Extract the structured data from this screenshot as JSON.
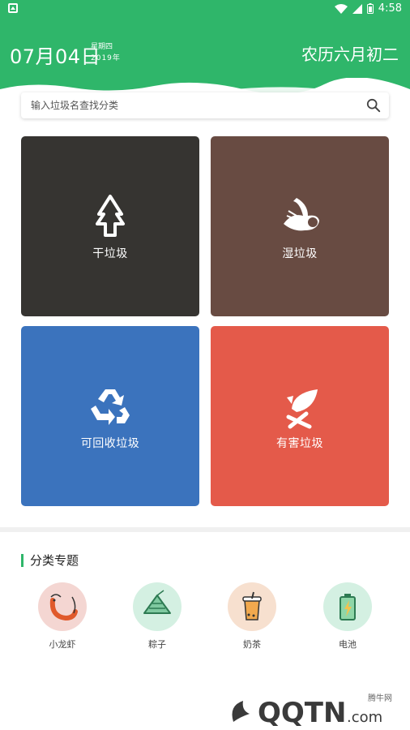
{
  "status_bar": {
    "time": "4:58"
  },
  "header": {
    "date": "07月04日",
    "weekday": "星期四",
    "year": "2019年",
    "lunar": "农历六月初二",
    "bg_color": "#2fb66a"
  },
  "search": {
    "placeholder": "输入垃圾名查找分类"
  },
  "categories": [
    {
      "label": "干垃圾",
      "color": "#363431",
      "icon": "dry-trash-icon"
    },
    {
      "label": "湿垃圾",
      "color": "#684b42",
      "icon": "wet-trash-icon"
    },
    {
      "label": "可回收垃圾",
      "color": "#3b73bd",
      "icon": "recycle-icon"
    },
    {
      "label": "有害垃圾",
      "color": "#e45a4a",
      "icon": "hazard-icon"
    }
  ],
  "topics": {
    "title": "分类专题",
    "items": [
      {
        "label": "小龙虾",
        "icon": "crayfish-icon"
      },
      {
        "label": "粽子",
        "icon": "zongzi-icon"
      },
      {
        "label": "奶茶",
        "icon": "milk-tea-icon"
      },
      {
        "label": "电池",
        "icon": "battery-icon"
      }
    ]
  },
  "watermark": {
    "text": "QQTN.com",
    "sub": "腾牛网"
  }
}
